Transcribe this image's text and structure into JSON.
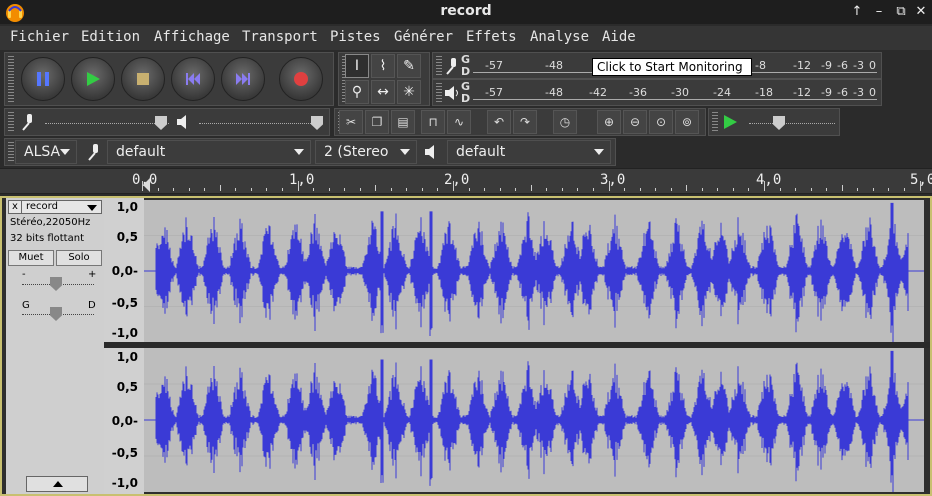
{
  "window": {
    "title": "record"
  },
  "menu": [
    "Fichier",
    "Edition",
    "Affichage",
    "Transport",
    "Pistes",
    "Générer",
    "Effets",
    "Analyse",
    "Aide"
  ],
  "transport": {
    "buttons": [
      "pause",
      "play",
      "stop",
      "skip-to-start",
      "skip-to-end",
      "record"
    ]
  },
  "meters": {
    "record_letters": [
      "G",
      "D"
    ],
    "play_letters": [
      "G",
      "D"
    ],
    "record_scale": [
      "-57",
      "-48",
      "-8",
      "-12",
      "-9",
      "-6",
      "-3",
      "0"
    ],
    "play_scale": [
      "-57",
      "-48",
      "-42",
      "-36",
      "-30",
      "-24",
      "-18",
      "-12",
      "-9",
      "-6",
      "-3",
      "0"
    ]
  },
  "tooltip": "Click to Start Monitoring",
  "device": {
    "host": "ALSA",
    "rec_device": "default",
    "channels": "2 (Stereo",
    "play_device": "default"
  },
  "ruler": {
    "labels": [
      "0,0",
      "1,0",
      "2,0",
      "3,0",
      "4,0",
      "5,0"
    ]
  },
  "track": {
    "name": "record",
    "format": "Stéréo,22050Hz",
    "bits": "32 bits flottant",
    "mute": "Muet",
    "solo": "Solo",
    "gain_minus": "-",
    "gain_plus": "+",
    "pan_left": "G",
    "pan_right": "D",
    "close": "x"
  },
  "vruler_labels": [
    "1,0",
    "0,5",
    "0,0-",
    "-0,5",
    "-1,0"
  ],
  "colors": {
    "waveform": "#3a3ad6",
    "background": "#bdbdbd",
    "selection_border": "#c8c070"
  }
}
